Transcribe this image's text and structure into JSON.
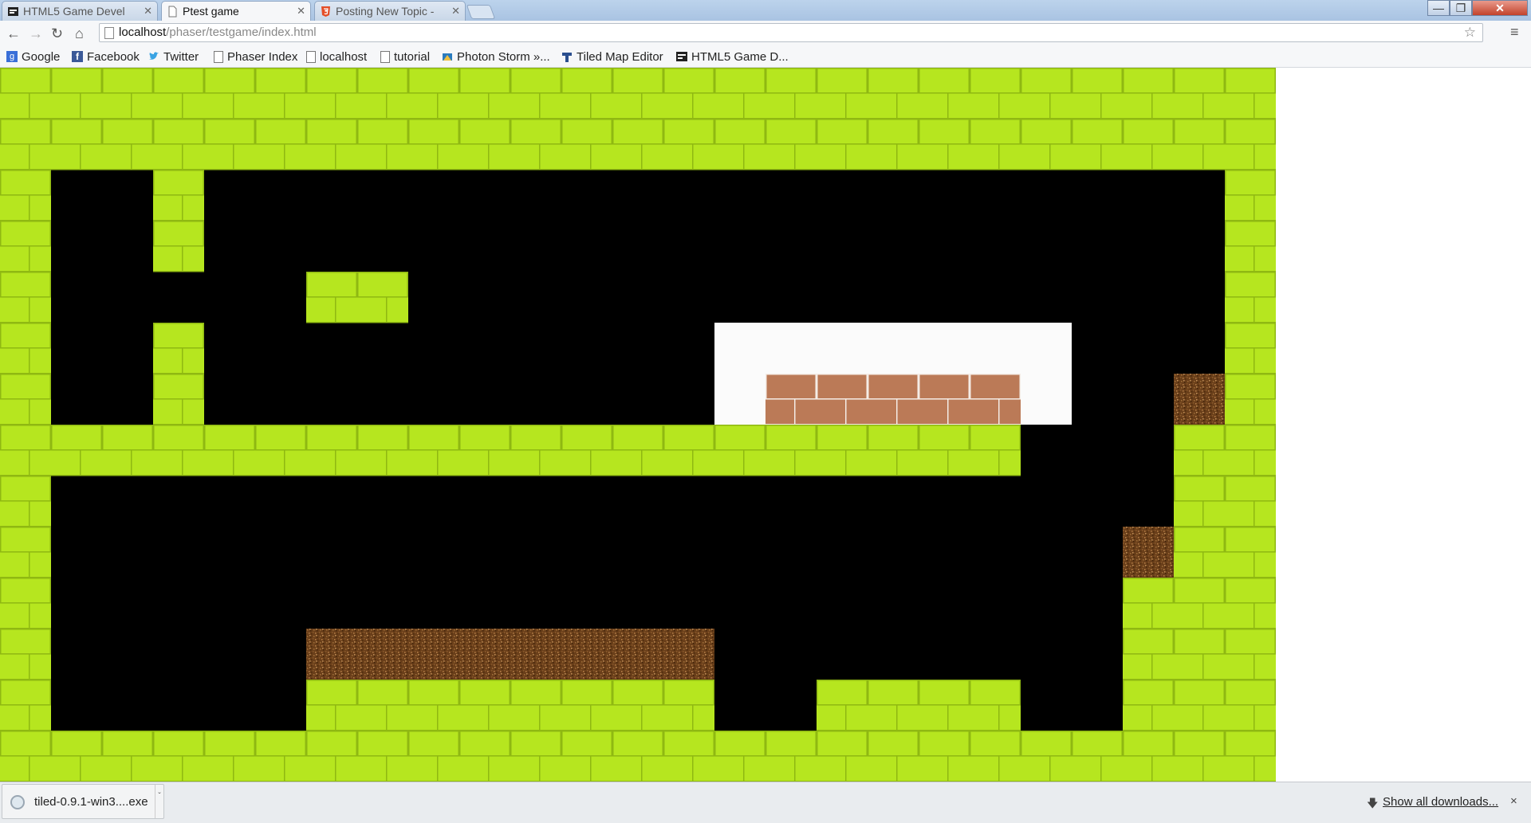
{
  "tabs": [
    {
      "title": "HTML5 Game Devel",
      "icon": "html5gamedevs-favicon-icon",
      "active": false
    },
    {
      "title": "Ptest game",
      "icon": "page-icon",
      "active": true
    },
    {
      "title": "Posting New Topic -",
      "icon": "html5-favicon-icon",
      "active": false
    }
  ],
  "window_controls": {
    "minimize": "—",
    "maximize": "❐",
    "close": "✕"
  },
  "toolbar": {
    "back": "←",
    "forward": "→",
    "reload": "↻",
    "home": "⌂",
    "url_host": "localhost",
    "url_path": "/phaser/testgame/index.html",
    "star": "☆",
    "menu": "≡"
  },
  "bookmarks": [
    {
      "label": "Google",
      "icon": "google-icon",
      "color": "#3a6fd8"
    },
    {
      "label": "Facebook",
      "icon": "facebook-icon",
      "color": "#3b5998"
    },
    {
      "label": "Twitter",
      "icon": "twitter-icon",
      "color": "#3aa3e3"
    },
    {
      "label": "Phaser Index",
      "icon": "page-icon"
    },
    {
      "label": "localhost",
      "icon": "page-icon"
    },
    {
      "label": "tutorial",
      "icon": "page-icon"
    },
    {
      "label": "Photon Storm »...",
      "icon": "photonstorm-icon",
      "color": "#2a7bbf"
    },
    {
      "label": "Tiled Map Editor",
      "icon": "tiled-icon",
      "color": "#2b4f8f"
    },
    {
      "label": "HTML5 Game D...",
      "icon": "html5gamedevs-favicon-icon",
      "color": "#222222"
    }
  ],
  "game": {
    "colors": {
      "grass": "#b6e61f",
      "grass_line": "#8fb812",
      "background": "#000000",
      "sky": "#fbfbfb",
      "brick": "#bb7a57",
      "dirt": "#6a3f1a"
    },
    "tile_grid": [
      "GGGGGGGGGGGGGGGGGGGGGGGGG",
      "GGGGGGGGGGGGGGGGGGGGGGGGG",
      "G..G....................G",
      "G..G....................G",
      "G.....GG................G",
      "G..G..........WWWWWWW...G",
      "G..G..........WBBBBBW..DG",
      "GGGGGGGGGGGGGGGGGGGG...GG",
      "G......................GG",
      "G.....................DGG",
      "G.....................GGG",
      "G.....DDDDDDDD........GGG",
      "G.....GGGGGGGG..GGGG..GGG",
      "GGGGGGGGGGGGGGGGGGGGGGGGG",
      "........................."
    ]
  },
  "downloads": {
    "file_name": "tiled-0.9.1-win3....exe",
    "show_all": "Show all downloads...",
    "close": "×"
  }
}
